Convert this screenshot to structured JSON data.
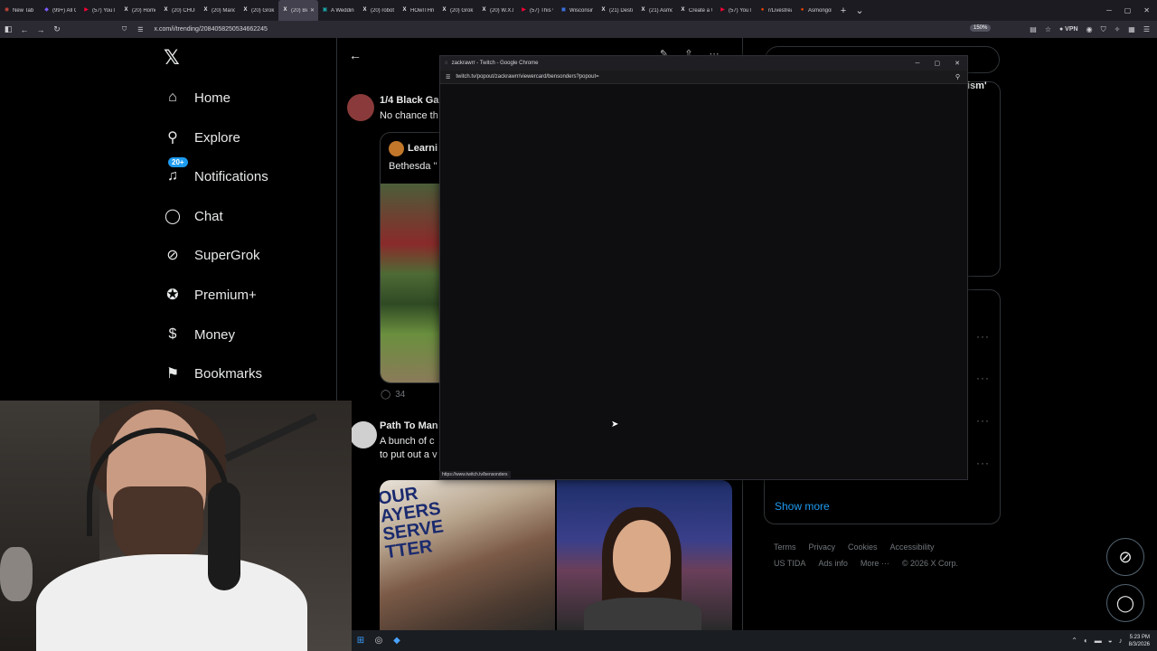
{
  "browser": {
    "tabs": [
      {
        "label": "New Tab",
        "color": "#d04a3a",
        "glyph": "◉"
      },
      {
        "label": "(99+) All Ca",
        "color": "#7b5cff",
        "glyph": "◆"
      },
      {
        "label": "(57) YouTub",
        "color": "#ff0033",
        "glyph": "▶"
      },
      {
        "label": "(20) Home /",
        "color": "#e7e9ea",
        "glyph": "X"
      },
      {
        "label": "(20) CHUD!",
        "color": "#e7e9ea",
        "glyph": "X"
      },
      {
        "label": "(20) Mario t",
        "color": "#e7e9ea",
        "glyph": "X"
      },
      {
        "label": "(20) Grok / ",
        "color": "#e7e9ea",
        "glyph": "X"
      },
      {
        "label": "(20) Beth",
        "color": "#e7e9ea",
        "glyph": "X",
        "active": true
      },
      {
        "label": "A Wedding",
        "color": "#1aa3a3",
        "glyph": "▣"
      },
      {
        "label": "(20) robot c",
        "color": "#e7e9ea",
        "glyph": "X"
      },
      {
        "label": "HOwITHnW",
        "color": "#e7e9ea",
        "glyph": "X"
      },
      {
        "label": "(20) Grok / ",
        "color": "#e7e9ea",
        "glyph": "X"
      },
      {
        "label": "(20) W.X.K",
        "color": "#e7e9ea",
        "glyph": "X"
      },
      {
        "label": "(57) This vic",
        "color": "#ff0033",
        "glyph": "▶"
      },
      {
        "label": "Wisconsin C",
        "color": "#3a6fd8",
        "glyph": "◼"
      },
      {
        "label": "(21) Destiny",
        "color": "#e7e9ea",
        "glyph": "X"
      },
      {
        "label": "(21) Asmon",
        "color": "#e7e9ea",
        "glyph": "X"
      },
      {
        "label": "Create a W",
        "color": "#e7e9ea",
        "glyph": "X"
      },
      {
        "label": "(57) YouTub",
        "color": "#ff0033",
        "glyph": "▶"
      },
      {
        "label": "r/Livestrean",
        "color": "#ff4500",
        "glyph": "●"
      },
      {
        "label": "Asmongold",
        "color": "#ff4500",
        "glyph": "●"
      }
    ],
    "new_tab": "+",
    "url": "x.com/i/trending/2084058250534662245",
    "zoom": "150%",
    "vpn": "VPN"
  },
  "nav": {
    "logo": "𝕏",
    "items": [
      {
        "label": "Home",
        "icon": "home-icon",
        "glyph": "⌂"
      },
      {
        "label": "Explore",
        "icon": "search-icon",
        "glyph": "⚲"
      },
      {
        "label": "Notifications",
        "icon": "bell-icon",
        "glyph": "♫",
        "badge": "20+"
      },
      {
        "label": "Chat",
        "icon": "chat-icon",
        "glyph": "◯"
      },
      {
        "label": "SuperGrok",
        "icon": "grok-icon",
        "glyph": "⊘"
      },
      {
        "label": "Premium+",
        "icon": "premium-icon",
        "glyph": "✪"
      },
      {
        "label": "Money",
        "icon": "money-icon",
        "glyph": "$"
      },
      {
        "label": "Bookmarks",
        "icon": "bookmark-icon",
        "glyph": "⚑"
      }
    ]
  },
  "posts": [
    {
      "name": "1/4 Black Ga",
      "text": "No chance th",
      "avatar_color": "#8a3a3a"
    },
    {
      "name": "Path To Man",
      "text_line1": "A bunch of c",
      "text_line2": "to put out a v",
      "avatar_color": "#d0d0d0"
    }
  ],
  "quote": {
    "name": "Learni",
    "text": "Bethesda \""
  },
  "reply_count": "34",
  "sign_text": "OUR\nAYERS\nSERVE\nTTER",
  "sidebar": {
    "card1_partial": "ism'",
    "show_more": "Show more",
    "footer_row1": [
      "Terms",
      "Privacy",
      "Cookies",
      "Accessibility"
    ],
    "footer_row2": [
      "US TIDA",
      "Ads info",
      "More ···",
      "© 2026 X Corp."
    ]
  },
  "popup": {
    "title": "zackrawrr - Twitch - Google Chrome",
    "url": "twitch.tv/popout/zackrawrr/viewercard/bensonders?popout=",
    "status_url": "https://www.twitch.tv/bensonders"
  },
  "taskbar": {
    "time": "5:23 PM",
    "date": "8/3/2026"
  }
}
